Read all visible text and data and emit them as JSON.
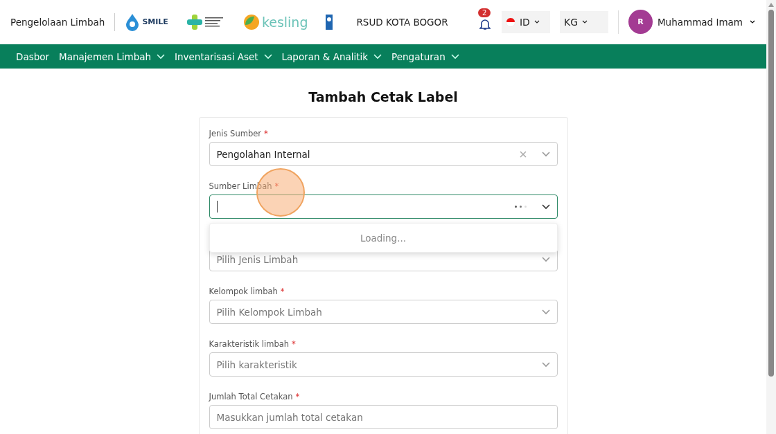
{
  "header": {
    "app_title": "Pengelolaan Limbah",
    "logos": [
      {
        "kind": "smile",
        "text": "SMILE"
      },
      {
        "kind": "kemenkes"
      },
      {
        "kind": "kesling",
        "text": "kesling"
      },
      {
        "kind": "undp"
      }
    ],
    "hospital": "RSUD KOTA BOGOR",
    "notifications": "2",
    "language": "ID",
    "unit": "KG",
    "user": {
      "initial": "R",
      "name": "Muhammad Imam"
    }
  },
  "nav": [
    {
      "label": "Dasbor",
      "dropdown": false
    },
    {
      "label": "Manajemen Limbah",
      "dropdown": true
    },
    {
      "label": "Inventarisasi Aset",
      "dropdown": true
    },
    {
      "label": "Laporan & Analitik",
      "dropdown": true
    },
    {
      "label": "Pengaturan",
      "dropdown": true
    }
  ],
  "page_title": "Tambah Cetak Label",
  "fields": [
    {
      "kind": "select",
      "label": "Jenis Sumber",
      "mark": "*",
      "value": "Pengolahan Internal"
    },
    {
      "kind": "loading",
      "label": "Sumber Limbah",
      "mark": "*",
      "menu": "Loading..."
    },
    {
      "kind": "select",
      "placeholder": "Pilih Jenis Limbah"
    },
    {
      "kind": "select",
      "label": "Kelompok limbah",
      "mark": "*",
      "placeholder": "Pilih Kelompok Limbah"
    },
    {
      "kind": "select",
      "label": "Karakteristik limbah",
      "mark": "*",
      "placeholder": "Pilih karakteristik"
    },
    {
      "kind": "input",
      "label": "Jumlah Total Cetakan",
      "mark": "*",
      "placeholder": "Masukkan jumlah total cetakan"
    }
  ]
}
